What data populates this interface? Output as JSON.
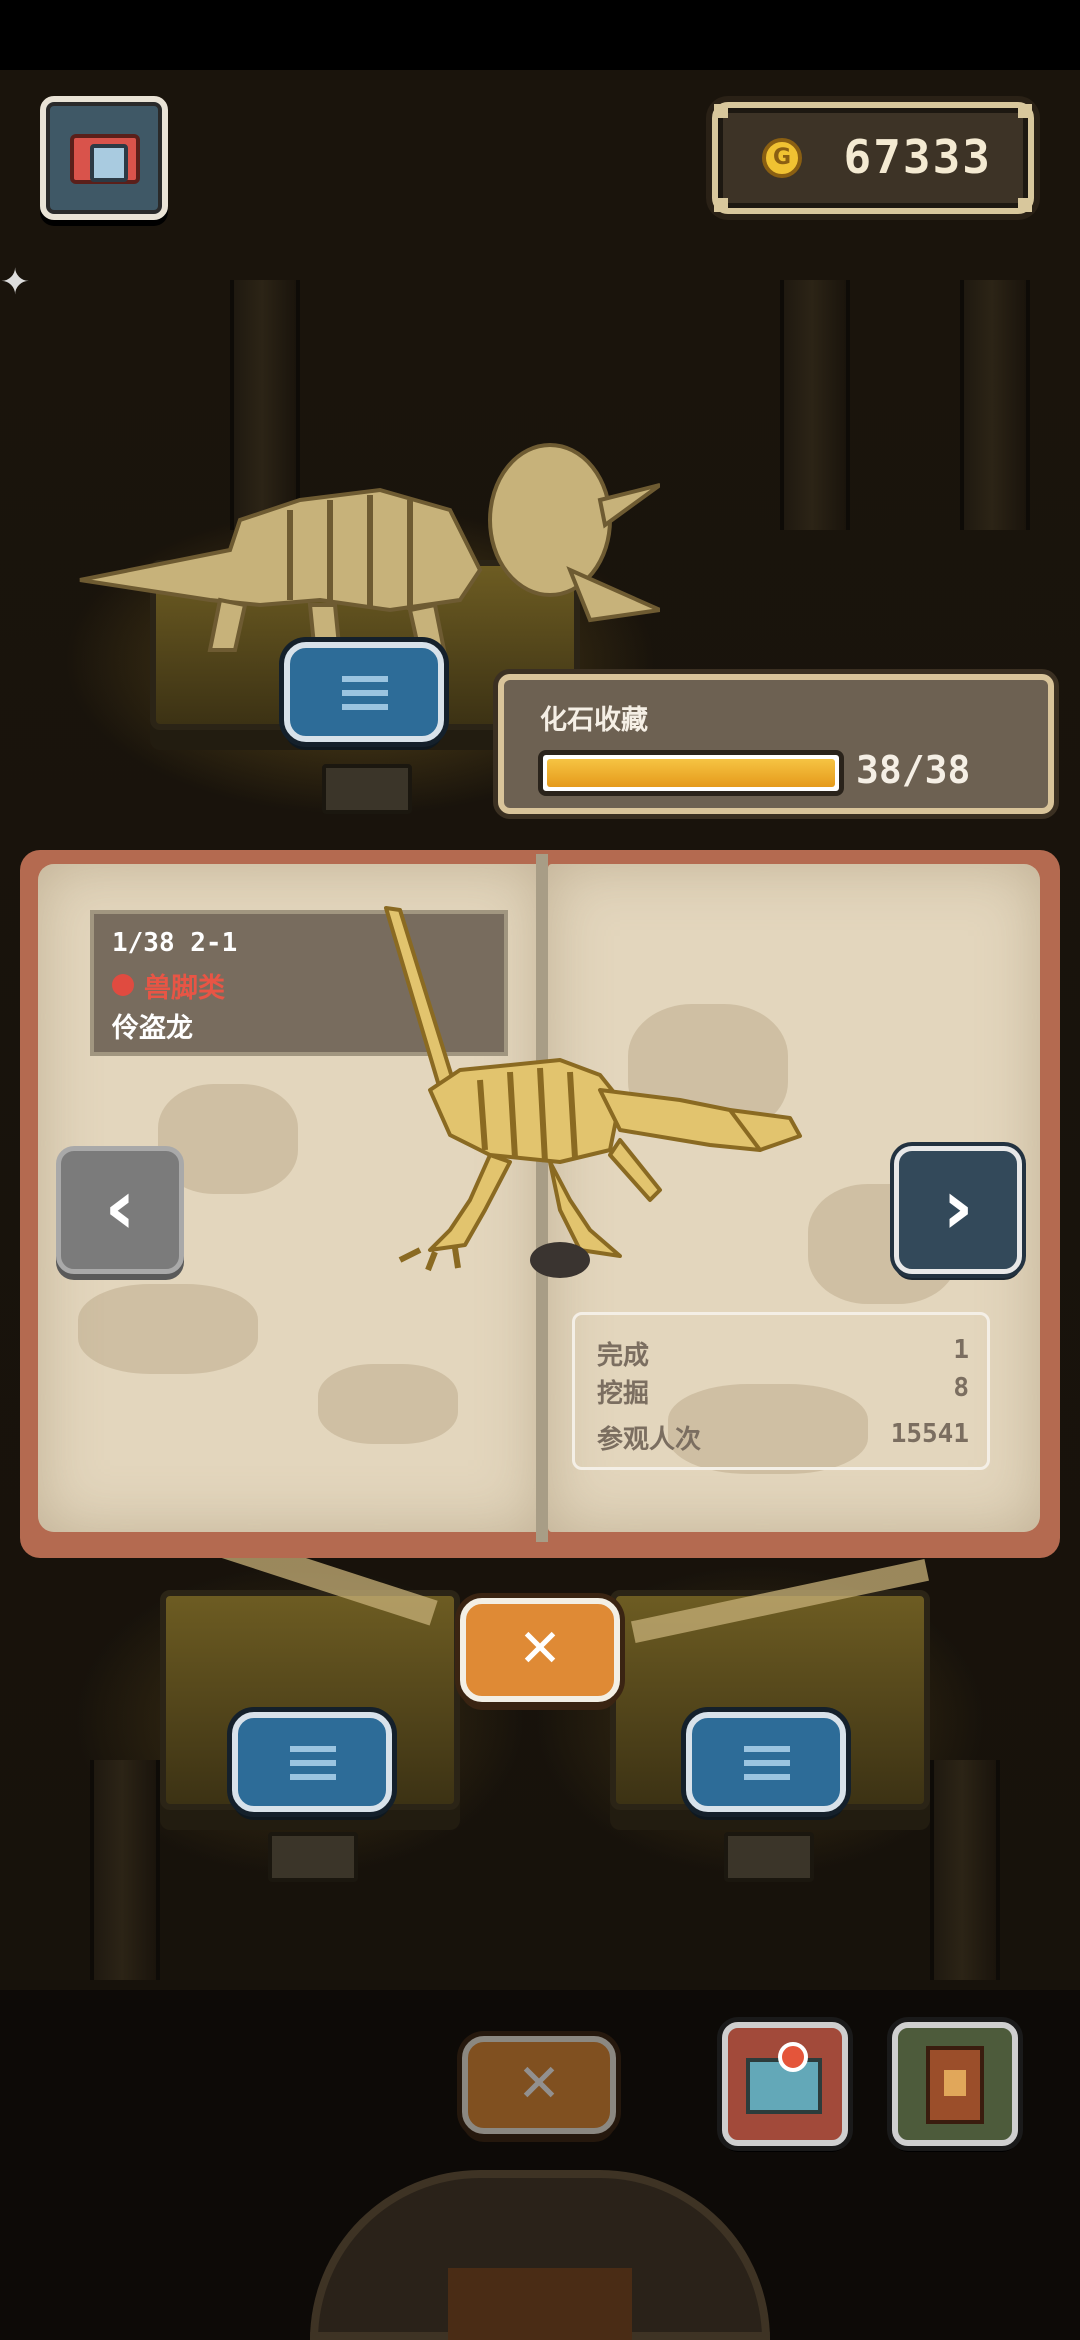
{
  "hud": {
    "coins": "67333",
    "coin_symbol": "G"
  },
  "collection": {
    "title": "化石收藏",
    "count": "38/38",
    "progress": 1.0
  },
  "fossil": {
    "index_label": "1/38 2-1",
    "category": "兽脚类",
    "name": "伶盗龙",
    "stats": [
      {
        "label": "完成",
        "value": "1"
      },
      {
        "label": "挖掘",
        "value": "8"
      },
      {
        "label": "参观人次",
        "value": "15541"
      }
    ]
  },
  "buttons": {
    "close": "✕",
    "prev": "‹",
    "next": "›"
  },
  "icons": {
    "camera": "camera-icon",
    "puzzle": "puzzle-icon",
    "list": "list-icon",
    "map": "map-icon",
    "book": "book-icon"
  },
  "colors": {
    "accent_orange": "#df8a35",
    "progress_fill": "#f2b53a",
    "category_red": "#e85545",
    "list_blue": "#2d6c98"
  }
}
